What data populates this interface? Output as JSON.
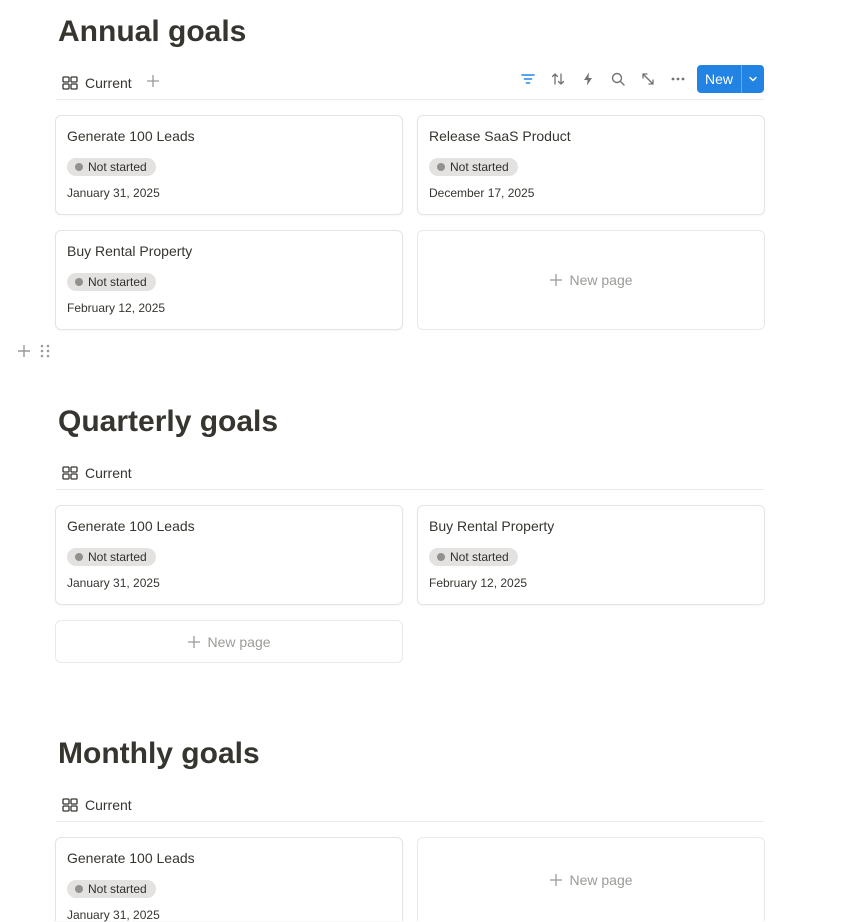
{
  "sections": [
    {
      "title": "Annual goals",
      "view_tab": "Current",
      "toolbar": {
        "new_label": "New"
      },
      "cards": [
        {
          "title": "Generate 100 Leads",
          "status": "Not started",
          "date": "January 31, 2025"
        },
        {
          "title": "Release SaaS Product",
          "status": "Not started",
          "date": "December 17, 2025"
        },
        {
          "title": "Buy Rental Property",
          "status": "Not started",
          "date": "February 12, 2025"
        }
      ],
      "new_page_label": "New page"
    },
    {
      "title": "Quarterly goals",
      "view_tab": "Current",
      "cards": [
        {
          "title": "Generate 100 Leads",
          "status": "Not started",
          "date": "January 31, 2025"
        },
        {
          "title": "Buy Rental Property",
          "status": "Not started",
          "date": "February 12, 2025"
        }
      ],
      "new_page_label": "New page"
    },
    {
      "title": "Monthly goals",
      "view_tab": "Current",
      "cards": [
        {
          "title": "Generate 100 Leads",
          "status": "Not started",
          "date": "January 31, 2025"
        }
      ],
      "new_page_label": "New page"
    }
  ],
  "icons": {
    "view": "gallery-grid-icon",
    "add": "plus-icon",
    "filter": "filter-icon",
    "sort": "sort-icon",
    "automation": "lightning-icon",
    "search": "search-icon",
    "expand": "expand-icon",
    "more": "more-horizontal-icon",
    "caret": "chevron-down-icon",
    "drag": "drag-handle-icon"
  },
  "colors": {
    "accent": "#2383e2",
    "status_bg": "#e3e2e0",
    "status_dot": "#91918e",
    "text": "#37352f"
  }
}
